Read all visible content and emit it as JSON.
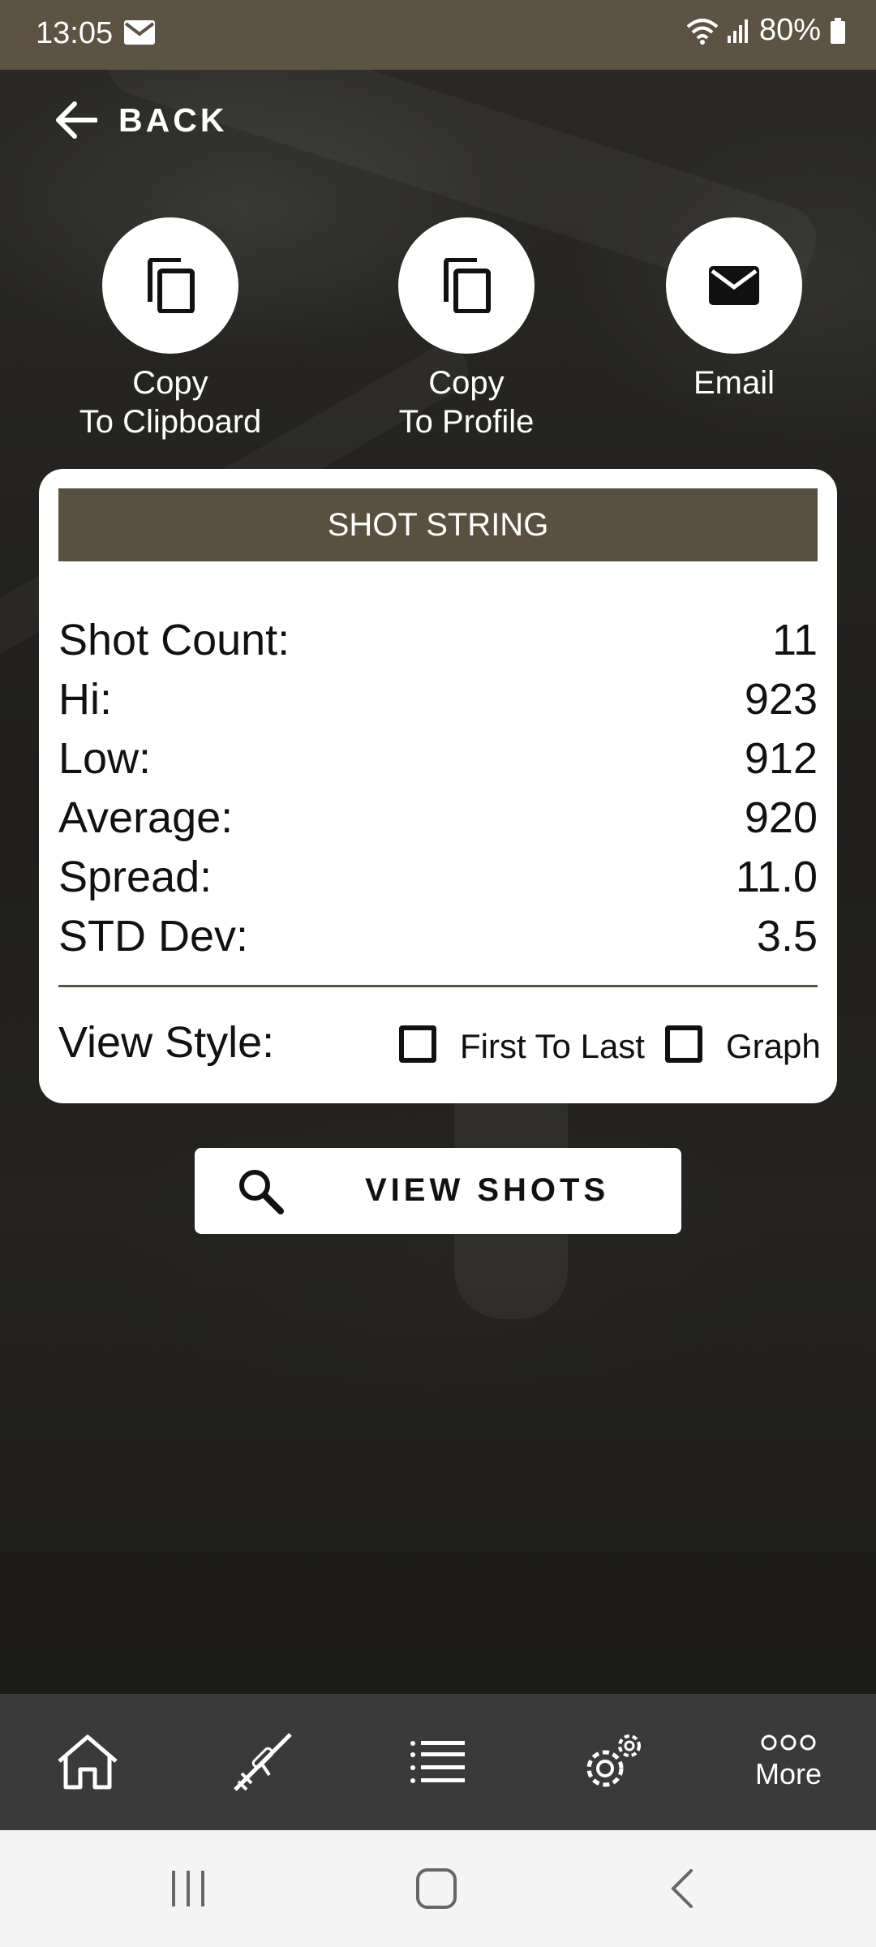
{
  "status_bar": {
    "time": "13:05",
    "battery": "80%"
  },
  "header": {
    "back_label": "BACK"
  },
  "actions": [
    {
      "line1": "Copy",
      "line2": "To Clipboard",
      "icon": "copy-icon"
    },
    {
      "line1": "Copy",
      "line2": "To Profile",
      "icon": "copy-icon"
    },
    {
      "line1": "Email",
      "line2": "",
      "icon": "mail-icon"
    }
  ],
  "card": {
    "title": "SHOT STRING",
    "stats": [
      {
        "label": "Shot Count:",
        "value": "11"
      },
      {
        "label": "Hi:",
        "value": "923"
      },
      {
        "label": "Low:",
        "value": "912"
      },
      {
        "label": "Average:",
        "value": "920"
      },
      {
        "label": "Spread:",
        "value": "11.0"
      },
      {
        "label": "STD Dev:",
        "value": "3.5"
      }
    ],
    "view_style_label": "View Style:",
    "options": [
      {
        "label": "First To Last",
        "checked": false
      },
      {
        "label": "Graph",
        "checked": false
      }
    ]
  },
  "view_shots_label": "VIEW SHOTS",
  "tab_bar": {
    "items": [
      {
        "icon": "home-icon"
      },
      {
        "icon": "rifle-icon"
      },
      {
        "icon": "list-icon"
      },
      {
        "icon": "gear-icon"
      },
      {
        "icon": "more-icon",
        "label": "More"
      }
    ]
  },
  "colors": {
    "accent": "#5a503f",
    "status_bar": "#5c5343",
    "tab_bar": "#3a3a3a"
  }
}
